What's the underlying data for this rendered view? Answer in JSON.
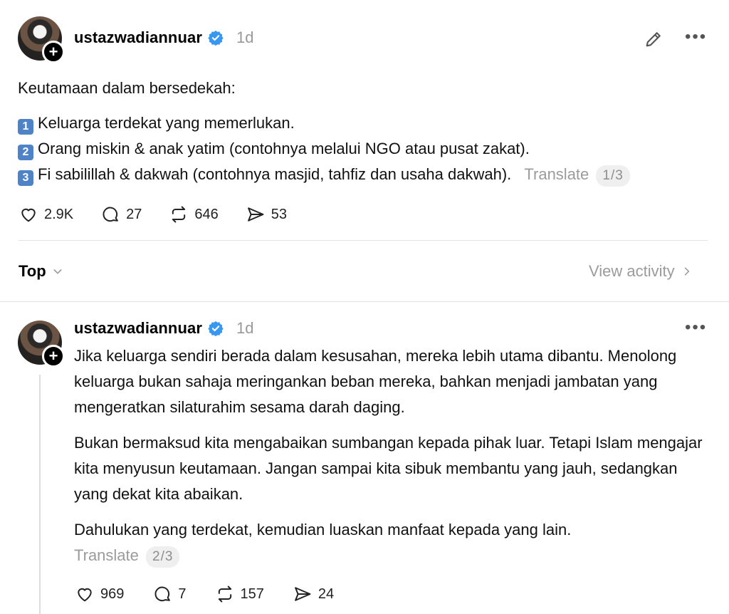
{
  "post": {
    "username": "ustazwadiannuar",
    "time": "1d",
    "intro": "Keutamaan dalam bersedekah:",
    "items": [
      {
        "num": "1",
        "text": "Keluarga terdekat yang memerlukan."
      },
      {
        "num": "2",
        "text": "Orang miskin & anak yatim (contohnya melalui NGO atau pusat zakat)."
      },
      {
        "num": "3",
        "text": "Fi sabilillah & dakwah (contohnya masjid, tahfiz dan usaha dakwah)."
      }
    ],
    "translate_label": "Translate",
    "page_indicator": "1/3",
    "likes": "2.9K",
    "comments": "27",
    "reposts": "646",
    "shares": "53"
  },
  "sort": {
    "label": "Top",
    "view_activity": "View activity"
  },
  "reply": {
    "username": "ustazwadiannuar",
    "time": "1d",
    "paragraphs": [
      "Jika keluarga sendiri berada dalam kesusahan, mereka lebih utama dibantu. Menolong keluarga bukan sahaja meringankan beban mereka, bahkan menjadi jambatan yang mengeratkan silaturahim sesama darah daging.",
      "Bukan bermaksud kita mengabaikan sumbangan kepada pihak luar. Tetapi Islam mengajar kita menyusun keutamaan. Jangan sampai kita sibuk membantu yang jauh, sedangkan yang dekat kita abaikan.",
      "Dahulukan yang terdekat, kemudian luaskan manfaat kepada yang lain."
    ],
    "translate_label": "Translate",
    "page_indicator": "2/3",
    "likes": "969",
    "comments": "7",
    "reposts": "157",
    "shares": "24"
  },
  "colors": {
    "verified": "#3897f0",
    "muted": "#9b9b9b",
    "divider": "#e2e2e2"
  }
}
